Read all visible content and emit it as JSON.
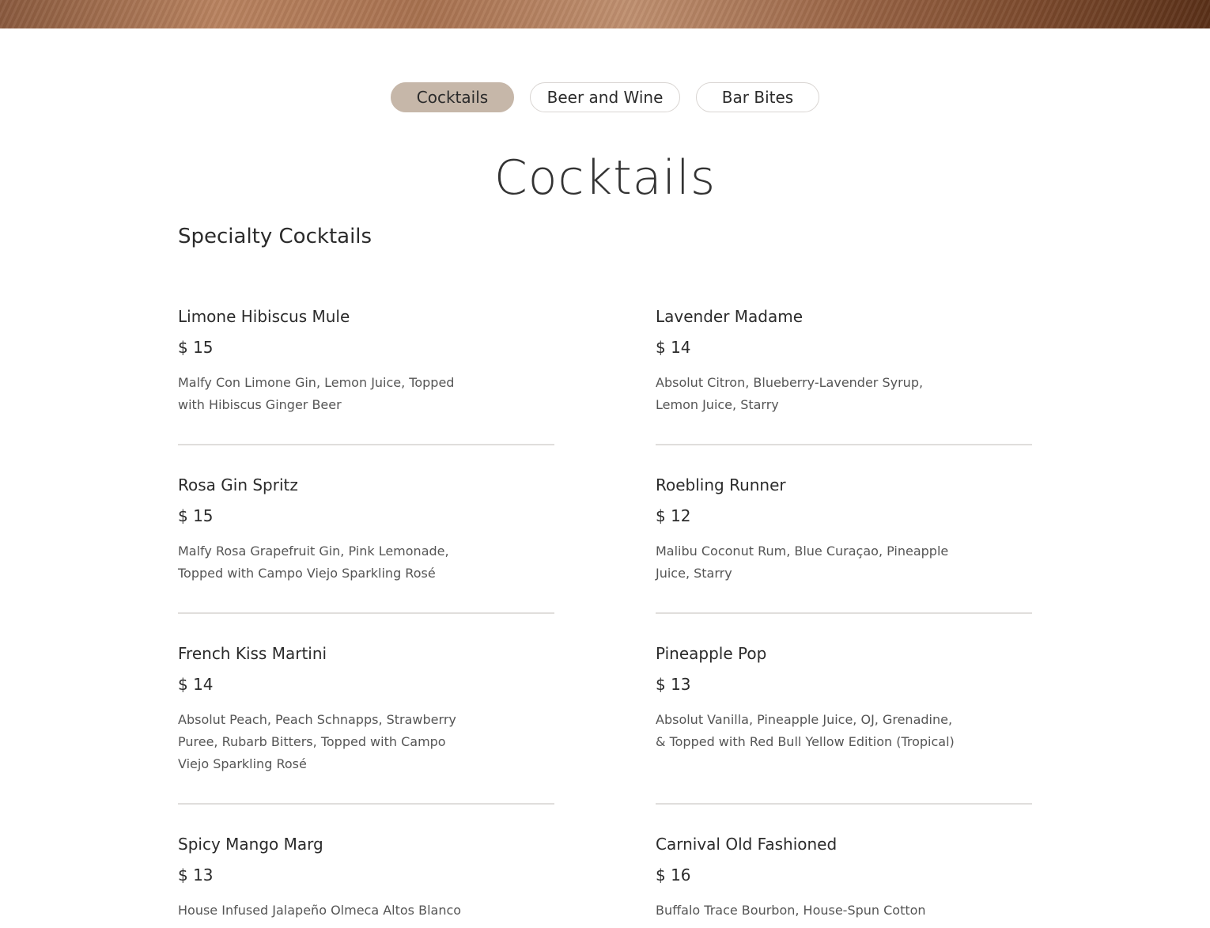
{
  "tabs": [
    {
      "label": "Cocktails",
      "active": true
    },
    {
      "label": "Beer and Wine",
      "active": false
    },
    {
      "label": "Bar Bites",
      "active": false
    }
  ],
  "section_title": "Cocktails",
  "subsection_title": "Specialty Cocktails",
  "items": [
    {
      "name": "Limone Hibiscus Mule",
      "price": "$ 15",
      "description": "Malfy Con Limone Gin, Lemon Juice, Topped with Hibiscus Ginger Beer"
    },
    {
      "name": "Lavender Madame",
      "price": "$ 14",
      "description": "Absolut Citron, Blueberry-Lavender Syrup, Lemon Juice, Starry"
    },
    {
      "name": "Rosa Gin Spritz",
      "price": "$ 15",
      "description": "Malfy Rosa Grapefruit Gin, Pink Lemonade, Topped with Campo Viejo Sparkling Rosé"
    },
    {
      "name": "Roebling Runner",
      "price": "$ 12",
      "description": "Malibu Coconut Rum, Blue Curaçao, Pineapple Juice, Starry"
    },
    {
      "name": "French Kiss Martini",
      "price": "$ 14",
      "description": "Absolut Peach, Peach Schnapps, Strawberry Puree, Rubarb Bitters, Topped with Campo Viejo Sparkling Rosé"
    },
    {
      "name": "Pineapple Pop",
      "price": "$ 13",
      "description": "Absolut Vanilla, Pineapple Juice, OJ, Grenadine, & Topped with Red Bull Yellow Edition (Tropical)"
    },
    {
      "name": "Spicy Mango Marg",
      "price": "$ 13",
      "description": "House Infused Jalapeño Olmeca Altos Blanco"
    },
    {
      "name": "Carnival Old Fashioned",
      "price": "$ 16",
      "description": "Buffalo Trace Bourbon, House-Spun Cotton"
    }
  ],
  "colors": {
    "active_tab": "#c6b7a9",
    "divider": "#e0dedc",
    "text": "#2b2b2b"
  }
}
